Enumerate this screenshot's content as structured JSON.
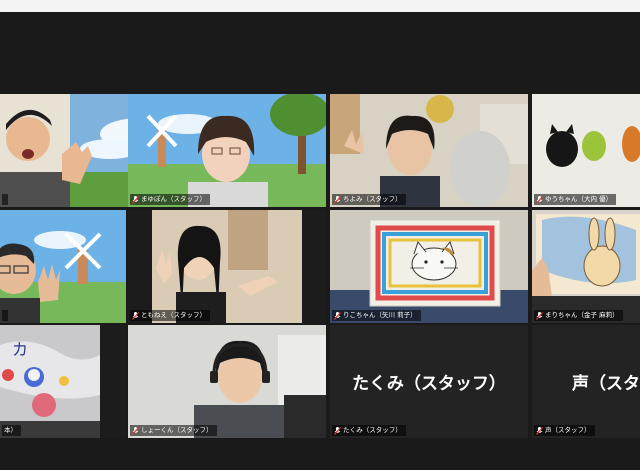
{
  "participants": [
    {
      "name": ""
    },
    {
      "name": "まゆぽん（スタッフ）"
    },
    {
      "name": "ちよみ（スタッフ）"
    },
    {
      "name": "ゆうちゃん（大内 優）"
    },
    {
      "name": ""
    },
    {
      "name": "ともねえ（スタッフ）"
    },
    {
      "name": "りこちゃん（矢川 莉子）"
    },
    {
      "name": "まりちゃん（金子 麻莉）"
    },
    {
      "name": "本）"
    },
    {
      "name": "しょーくん（スタッフ）"
    },
    {
      "name": "たくみ（スタッフ）",
      "display": "たくみ（スタッフ）"
    },
    {
      "name": "声（スタッフ）",
      "display": "声（スタ"
    }
  ],
  "icons": {
    "muted": "mic-muted-icon"
  },
  "colors": {
    "muted": "#e03a3a",
    "active_border": "#e6e03a",
    "background": "#1a1a1a"
  },
  "drawing_text": "カ"
}
